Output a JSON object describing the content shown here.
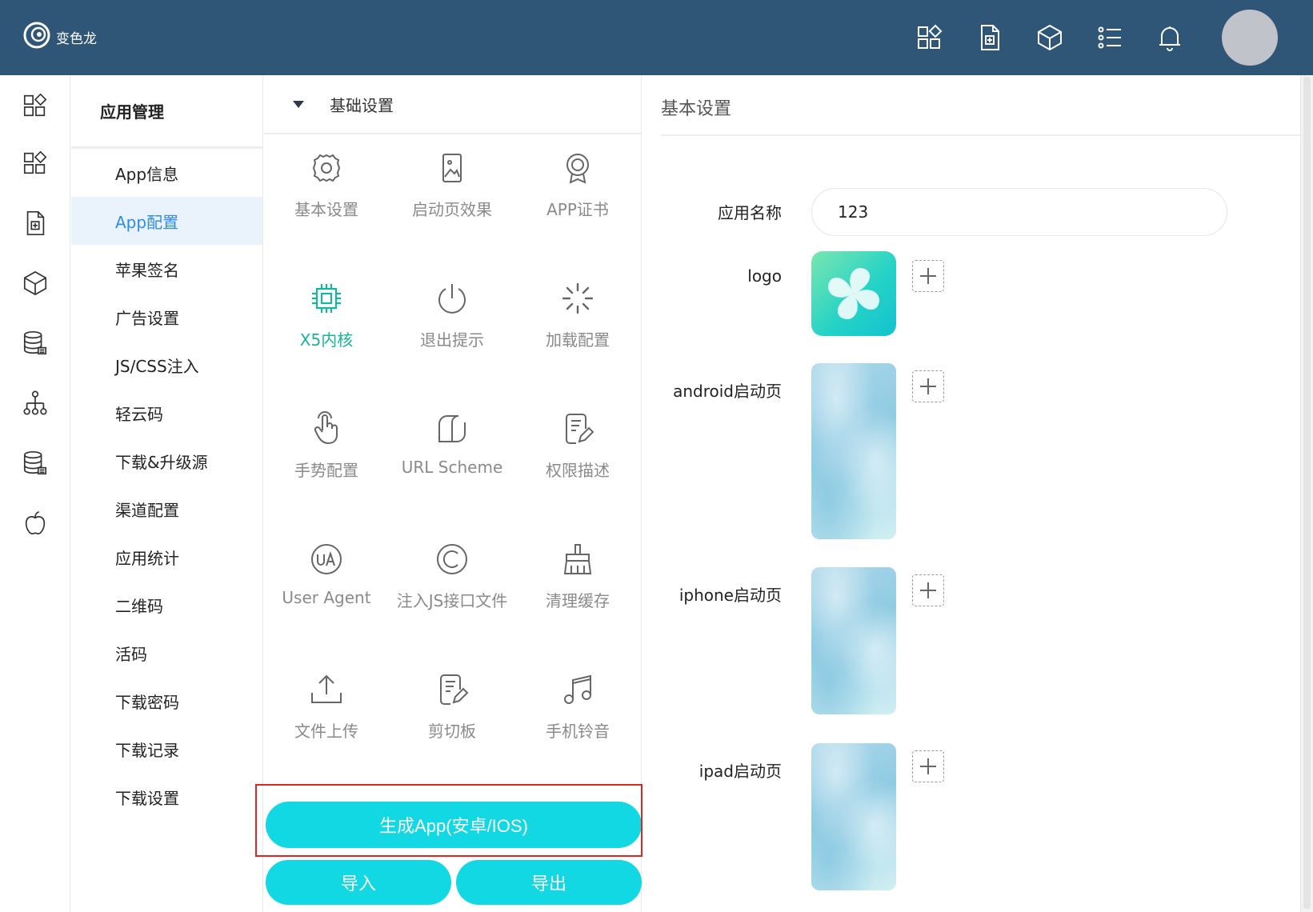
{
  "header": {
    "brand": "变色龙",
    "icons": [
      "apps-icon",
      "document-icon",
      "cube-icon",
      "list-icon",
      "bell-icon"
    ]
  },
  "rail": {
    "icons": [
      "apps-icon",
      "apps-alt-icon",
      "document-icon",
      "cube-icon",
      "database-icon",
      "hierarchy-icon",
      "database-alt-icon",
      "apple-icon"
    ]
  },
  "subnav": {
    "title": "应用管理",
    "items": [
      {
        "label": "App信息"
      },
      {
        "label": "App配置",
        "active": true
      },
      {
        "label": "苹果签名"
      },
      {
        "label": "广告设置"
      },
      {
        "label": "JS/CSS注入"
      },
      {
        "label": "轻云码"
      },
      {
        "label": "下载&升级源"
      },
      {
        "label": "渠道配置"
      },
      {
        "label": "应用统计"
      },
      {
        "label": "二维码"
      },
      {
        "label": "活码"
      },
      {
        "label": "下载密码"
      },
      {
        "label": "下载记录"
      },
      {
        "label": "下载设置"
      }
    ]
  },
  "config": {
    "section": "基础设置",
    "tiles": [
      {
        "label": "基本设置",
        "icon": "gear-icon"
      },
      {
        "label": "启动页效果",
        "icon": "image-icon"
      },
      {
        "label": "APP证书",
        "icon": "certificate-icon"
      },
      {
        "label": "X5内核",
        "icon": "chip-icon",
        "active": true
      },
      {
        "label": "退出提示",
        "icon": "power-icon"
      },
      {
        "label": "加载配置",
        "icon": "loading-icon"
      },
      {
        "label": "手势配置",
        "icon": "hand-icon"
      },
      {
        "label": "URL Scheme",
        "icon": "scheme-icon"
      },
      {
        "label": "权限描述",
        "icon": "edit-doc-icon"
      },
      {
        "label": "User Agent",
        "icon": "ua-icon"
      },
      {
        "label": "注入JS接口文件",
        "icon": "copyright-icon"
      },
      {
        "label": "清理缓存",
        "icon": "broom-icon"
      },
      {
        "label": "文件上传",
        "icon": "upload-icon"
      },
      {
        "label": "剪切板",
        "icon": "clipboard-icon"
      },
      {
        "label": "手机铃音",
        "icon": "music-icon"
      }
    ],
    "generate_label": "生成App(安卓/IOS)",
    "import_label": "导入",
    "export_label": "导出"
  },
  "basic": {
    "title": "基本设置",
    "name_label": "应用名称",
    "name_value": "123",
    "logo_label": "logo",
    "android_label": "android启动页",
    "iphone_label": "iphone启动页",
    "ipad_label": "ipad启动页"
  },
  "colors": {
    "header_bg": "#2f5577",
    "accent": "#2d8cf0",
    "active_tile": "#18b49b",
    "button": "#12d8e3",
    "highlight": "#e02424"
  }
}
